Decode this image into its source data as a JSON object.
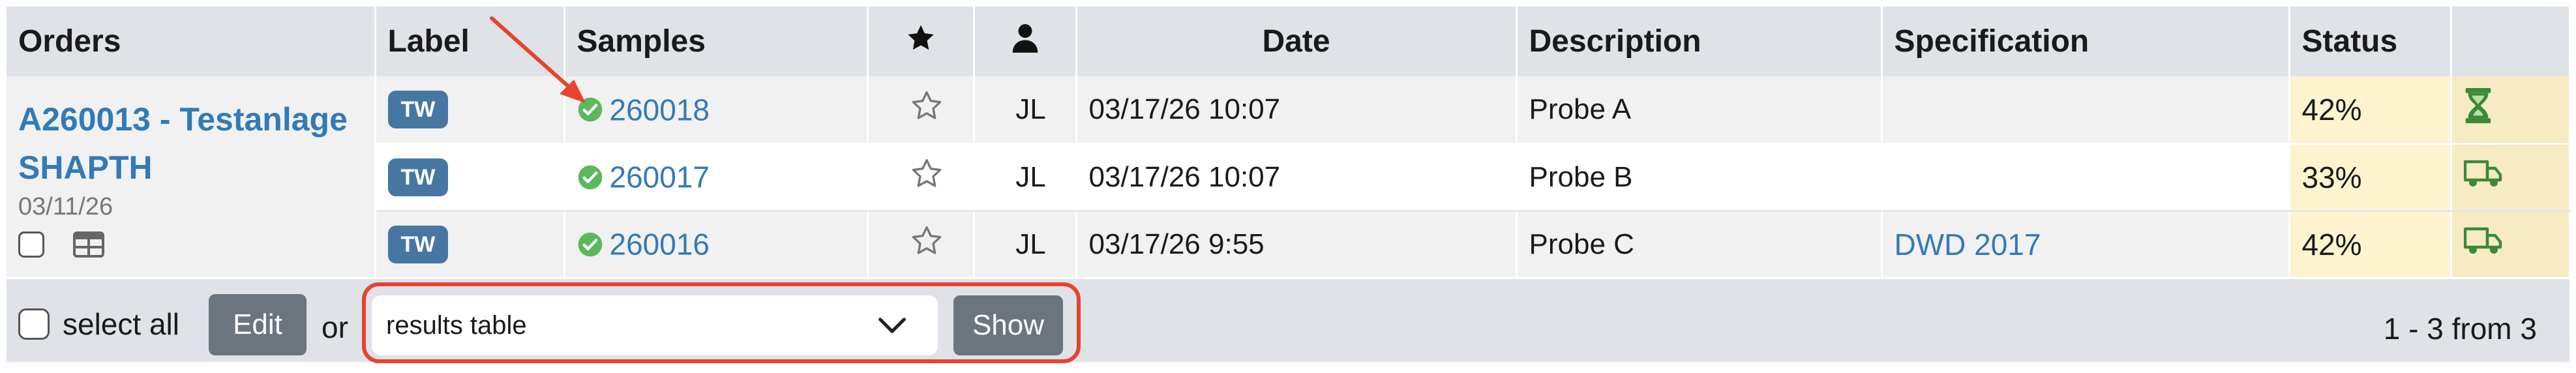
{
  "colors": {
    "link": "#337ab7",
    "badge": "#4677a3",
    "status_bg": "#fdf4cf",
    "ok_green": "#5cb85c",
    "truck_green": "#3a8a3a",
    "annotation": "#e8432e"
  },
  "header": {
    "orders": "Orders",
    "label": "Label",
    "samples": "Samples",
    "starred_icon": "star-filled-icon",
    "person_icon": "user-icon",
    "date": "Date",
    "description": "Description",
    "specification": "Specification",
    "status": "Status"
  },
  "order": {
    "title": "A260013 - Testanlage SHAPTH",
    "date": "03/11/26",
    "table_icon": "table-icon"
  },
  "rows": [
    {
      "label": "TW",
      "sample": "260018",
      "sample_icon": "check-circle-icon",
      "star_icon": "star-outline-icon",
      "user": "JL",
      "date": "03/17/26 10:07",
      "description": "Probe A",
      "specification": "",
      "status": "42%",
      "status_icon": "hourglass-icon"
    },
    {
      "label": "TW",
      "sample": "260017",
      "sample_icon": "check-circle-icon",
      "star_icon": "star-outline-icon",
      "user": "JL",
      "date": "03/17/26 10:07",
      "description": "Probe B",
      "specification": "",
      "status": "33%",
      "status_icon": "truck-icon"
    },
    {
      "label": "TW",
      "sample": "260016",
      "sample_icon": "check-circle-icon",
      "star_icon": "star-outline-icon",
      "user": "JL",
      "date": "03/17/26 9:55",
      "description": "Probe C",
      "specification": "DWD 2017",
      "status": "42%",
      "status_icon": "truck-icon"
    }
  ],
  "footer": {
    "select_all": "select all",
    "edit": "Edit",
    "or": "or",
    "select_value": "results table",
    "show": "Show",
    "pagination": "1 - 3 from 3"
  }
}
